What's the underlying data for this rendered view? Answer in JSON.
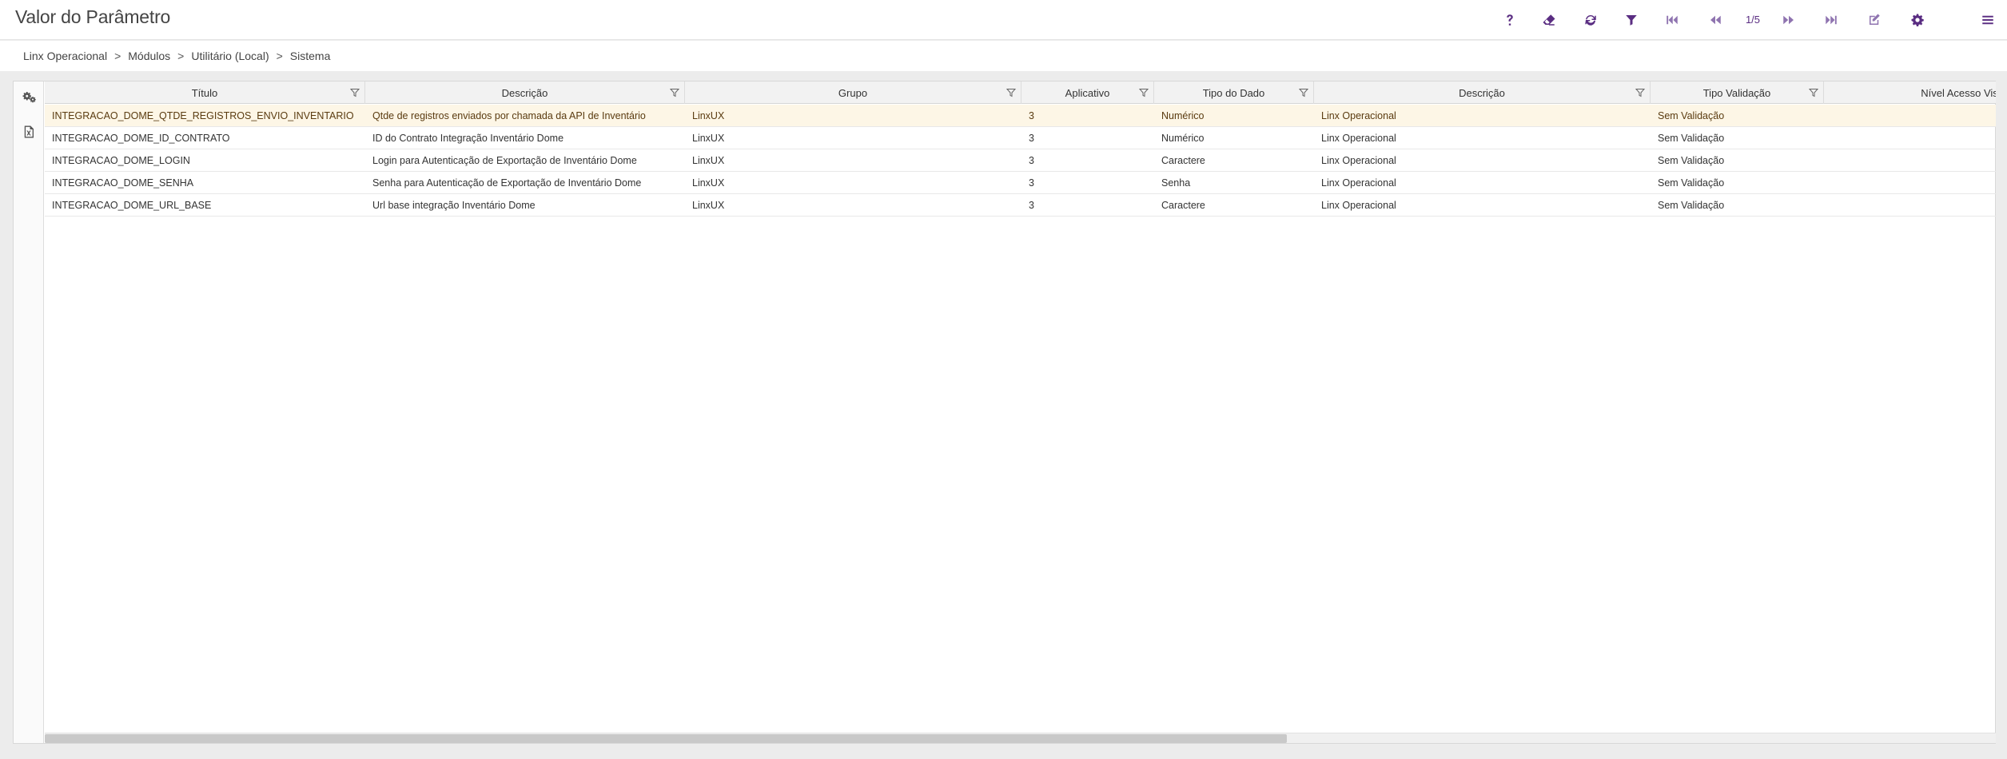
{
  "header": {
    "title": "Valor do Parâmetro",
    "pager": "1/5",
    "accent_color": "#5a2d82"
  },
  "toolbar": [
    {
      "name": "help-icon"
    },
    {
      "name": "eraser-icon"
    },
    {
      "name": "refresh-icon"
    },
    {
      "name": "filter-icon"
    },
    {
      "name": "first-page-icon"
    },
    {
      "name": "previous-page-icon"
    },
    {
      "name": "next-page-icon"
    },
    {
      "name": "last-page-icon"
    },
    {
      "name": "edit-icon"
    },
    {
      "name": "gear-icon"
    },
    {
      "name": "menu-icon"
    }
  ],
  "breadcrumb": {
    "items": [
      "Linx Operacional",
      "Módulos",
      "Utilitário (Local)",
      "Sistema"
    ],
    "separator": ">"
  },
  "side_icons": [
    "gears-icon",
    "excel-export-icon"
  ],
  "table": {
    "columns": [
      "Título",
      "Descrição",
      "Grupo",
      "Aplicativo",
      "Tipo do Dado",
      "Descrição",
      "Tipo Validação",
      "Nível Acesso Visualiza"
    ],
    "rows": [
      [
        "INTEGRACAO_DOME_QTDE_REGISTROS_ENVIO_INVENTARIO",
        "Qtde de registros enviados por chamada da API de Inventário",
        "LinxUX",
        "3",
        "Numérico",
        "Linx Operacional",
        "Sem Validação",
        ""
      ],
      [
        "INTEGRACAO_DOME_ID_CONTRATO",
        "ID do Contrato Integração Inventário Dome",
        "LinxUX",
        "3",
        "Numérico",
        "Linx Operacional",
        "Sem Validação",
        ""
      ],
      [
        "INTEGRACAO_DOME_LOGIN",
        "Login para Autenticação de Exportação de Inventário Dome",
        "LinxUX",
        "3",
        "Caractere",
        "Linx Operacional",
        "Sem Validação",
        ""
      ],
      [
        "INTEGRACAO_DOME_SENHA",
        "Senha para Autenticação de Exportação de Inventário Dome",
        "LinxUX",
        "3",
        "Senha",
        "Linx Operacional",
        "Sem Validação",
        ""
      ],
      [
        "INTEGRACAO_DOME_URL_BASE",
        "Url base integração Inventário Dome",
        "LinxUX",
        "3",
        "Caractere",
        "Linx Operacional",
        "Sem Validação",
        ""
      ]
    ],
    "selected_row": 0,
    "selected_color": "#fdf6e6"
  }
}
